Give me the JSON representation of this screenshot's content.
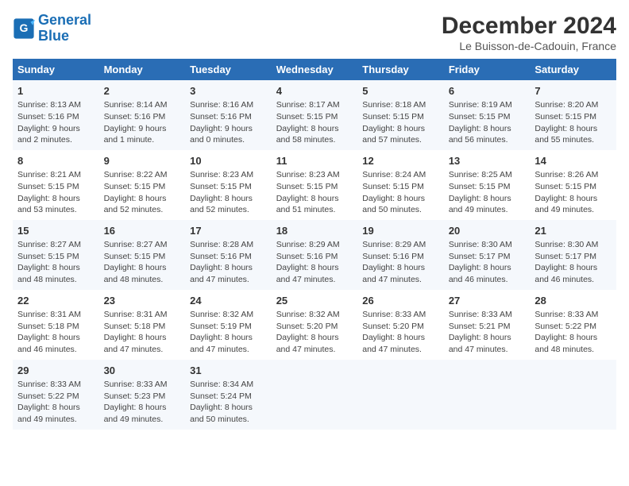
{
  "logo": {
    "line1": "General",
    "line2": "Blue"
  },
  "title": "December 2024",
  "subtitle": "Le Buisson-de-Cadouin, France",
  "headers": [
    "Sunday",
    "Monday",
    "Tuesday",
    "Wednesday",
    "Thursday",
    "Friday",
    "Saturday"
  ],
  "weeks": [
    [
      {
        "day": "1",
        "info": "Sunrise: 8:13 AM\nSunset: 5:16 PM\nDaylight: 9 hours\nand 2 minutes."
      },
      {
        "day": "2",
        "info": "Sunrise: 8:14 AM\nSunset: 5:16 PM\nDaylight: 9 hours\nand 1 minute."
      },
      {
        "day": "3",
        "info": "Sunrise: 8:16 AM\nSunset: 5:16 PM\nDaylight: 9 hours\nand 0 minutes."
      },
      {
        "day": "4",
        "info": "Sunrise: 8:17 AM\nSunset: 5:15 PM\nDaylight: 8 hours\nand 58 minutes."
      },
      {
        "day": "5",
        "info": "Sunrise: 8:18 AM\nSunset: 5:15 PM\nDaylight: 8 hours\nand 57 minutes."
      },
      {
        "day": "6",
        "info": "Sunrise: 8:19 AM\nSunset: 5:15 PM\nDaylight: 8 hours\nand 56 minutes."
      },
      {
        "day": "7",
        "info": "Sunrise: 8:20 AM\nSunset: 5:15 PM\nDaylight: 8 hours\nand 55 minutes."
      }
    ],
    [
      {
        "day": "8",
        "info": "Sunrise: 8:21 AM\nSunset: 5:15 PM\nDaylight: 8 hours\nand 53 minutes."
      },
      {
        "day": "9",
        "info": "Sunrise: 8:22 AM\nSunset: 5:15 PM\nDaylight: 8 hours\nand 52 minutes."
      },
      {
        "day": "10",
        "info": "Sunrise: 8:23 AM\nSunset: 5:15 PM\nDaylight: 8 hours\nand 52 minutes."
      },
      {
        "day": "11",
        "info": "Sunrise: 8:23 AM\nSunset: 5:15 PM\nDaylight: 8 hours\nand 51 minutes."
      },
      {
        "day": "12",
        "info": "Sunrise: 8:24 AM\nSunset: 5:15 PM\nDaylight: 8 hours\nand 50 minutes."
      },
      {
        "day": "13",
        "info": "Sunrise: 8:25 AM\nSunset: 5:15 PM\nDaylight: 8 hours\nand 49 minutes."
      },
      {
        "day": "14",
        "info": "Sunrise: 8:26 AM\nSunset: 5:15 PM\nDaylight: 8 hours\nand 49 minutes."
      }
    ],
    [
      {
        "day": "15",
        "info": "Sunrise: 8:27 AM\nSunset: 5:15 PM\nDaylight: 8 hours\nand 48 minutes."
      },
      {
        "day": "16",
        "info": "Sunrise: 8:27 AM\nSunset: 5:15 PM\nDaylight: 8 hours\nand 48 minutes."
      },
      {
        "day": "17",
        "info": "Sunrise: 8:28 AM\nSunset: 5:16 PM\nDaylight: 8 hours\nand 47 minutes."
      },
      {
        "day": "18",
        "info": "Sunrise: 8:29 AM\nSunset: 5:16 PM\nDaylight: 8 hours\nand 47 minutes."
      },
      {
        "day": "19",
        "info": "Sunrise: 8:29 AM\nSunset: 5:16 PM\nDaylight: 8 hours\nand 47 minutes."
      },
      {
        "day": "20",
        "info": "Sunrise: 8:30 AM\nSunset: 5:17 PM\nDaylight: 8 hours\nand 46 minutes."
      },
      {
        "day": "21",
        "info": "Sunrise: 8:30 AM\nSunset: 5:17 PM\nDaylight: 8 hours\nand 46 minutes."
      }
    ],
    [
      {
        "day": "22",
        "info": "Sunrise: 8:31 AM\nSunset: 5:18 PM\nDaylight: 8 hours\nand 46 minutes."
      },
      {
        "day": "23",
        "info": "Sunrise: 8:31 AM\nSunset: 5:18 PM\nDaylight: 8 hours\nand 47 minutes."
      },
      {
        "day": "24",
        "info": "Sunrise: 8:32 AM\nSunset: 5:19 PM\nDaylight: 8 hours\nand 47 minutes."
      },
      {
        "day": "25",
        "info": "Sunrise: 8:32 AM\nSunset: 5:20 PM\nDaylight: 8 hours\nand 47 minutes."
      },
      {
        "day": "26",
        "info": "Sunrise: 8:33 AM\nSunset: 5:20 PM\nDaylight: 8 hours\nand 47 minutes."
      },
      {
        "day": "27",
        "info": "Sunrise: 8:33 AM\nSunset: 5:21 PM\nDaylight: 8 hours\nand 47 minutes."
      },
      {
        "day": "28",
        "info": "Sunrise: 8:33 AM\nSunset: 5:22 PM\nDaylight: 8 hours\nand 48 minutes."
      }
    ],
    [
      {
        "day": "29",
        "info": "Sunrise: 8:33 AM\nSunset: 5:22 PM\nDaylight: 8 hours\nand 49 minutes."
      },
      {
        "day": "30",
        "info": "Sunrise: 8:33 AM\nSunset: 5:23 PM\nDaylight: 8 hours\nand 49 minutes."
      },
      {
        "day": "31",
        "info": "Sunrise: 8:34 AM\nSunset: 5:24 PM\nDaylight: 8 hours\nand 50 minutes."
      },
      {
        "day": "",
        "info": ""
      },
      {
        "day": "",
        "info": ""
      },
      {
        "day": "",
        "info": ""
      },
      {
        "day": "",
        "info": ""
      }
    ]
  ]
}
